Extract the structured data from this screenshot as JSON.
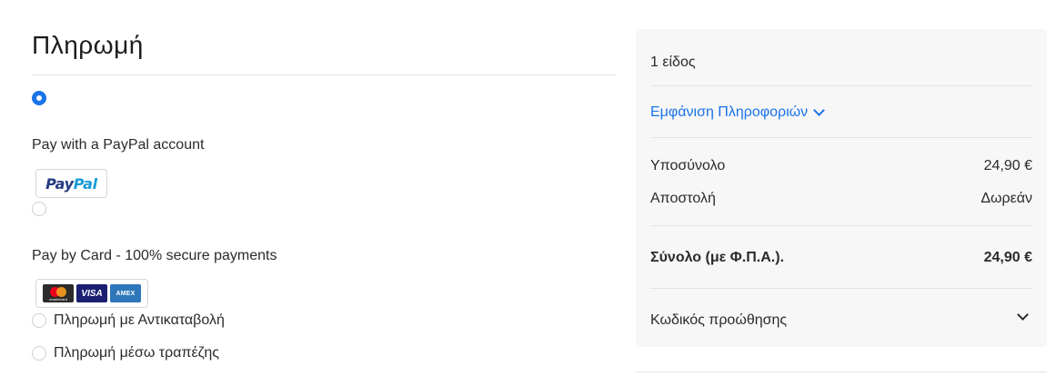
{
  "payment": {
    "title": "Πληρωμή",
    "options": [
      {
        "label": "",
        "selected": true
      },
      {
        "label": "Pay with a PayPal account",
        "selected": false,
        "logo_text_a": "Pay",
        "logo_text_b": "Pal"
      },
      {
        "label": "Pay by Card - 100% secure payments",
        "selected": false,
        "card_logos": [
          "mastercard-icon",
          "visa-icon",
          "amex-icon"
        ],
        "mastercard_text": "mastercard",
        "visa_text": "VISA",
        "amex_text": "AMEX"
      },
      {
        "label": "Πληρωμή με Αντικαταβολή",
        "selected": false
      },
      {
        "label": "Πληρωμή μέσω τραπέζης",
        "selected": false
      }
    ]
  },
  "summary": {
    "items_count": "1 είδος",
    "show_details": "Εμφάνιση Πληροφοριών",
    "subtotal_label": "Υποσύνολο",
    "subtotal_value": "24,90 €",
    "shipping_label": "Αποστολή",
    "shipping_value": "Δωρεάν",
    "total_label": "Σύνολο (με Φ.Π.Α.).",
    "total_value": "24,90 €",
    "promo_label": "Κωδικός προώθησης"
  },
  "colors": {
    "accent": "#1a73e8",
    "summary_bg": "#f7f7f8"
  }
}
